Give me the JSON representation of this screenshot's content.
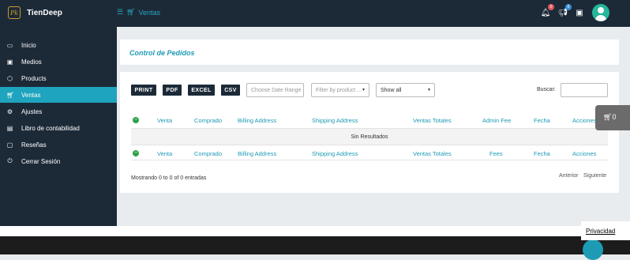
{
  "topbar": {
    "logo_text": "Pk",
    "brand": "TienDeep",
    "breadcrumb": "Ventas",
    "notifications_badge": "0",
    "announcements_badge": "0"
  },
  "sidebar": {
    "items": [
      {
        "label": "Inicio",
        "icon": "monitor-icon"
      },
      {
        "label": "Medios",
        "icon": "image-icon"
      },
      {
        "label": "Products",
        "icon": "box-icon"
      },
      {
        "label": "Ventas",
        "icon": "cart-icon",
        "active": true
      },
      {
        "label": "Ajustes",
        "icon": "gears-icon"
      },
      {
        "label": "Libro de contabilidad",
        "icon": "file-icon"
      },
      {
        "label": "Reseñas",
        "icon": "comment-icon"
      },
      {
        "label": "Cerrar Sesión",
        "icon": "power-icon"
      }
    ]
  },
  "page": {
    "title": "Control de Pedidos"
  },
  "toolbar": {
    "print": "PRINT",
    "pdf": "PDF",
    "excel": "EXCEL",
    "csv": "CSV",
    "date_range_placeholder": "Choose Date Range",
    "product_filter": "Filter by product ...",
    "show_select": "Show all",
    "search_label": "Buscar:"
  },
  "table": {
    "header": [
      "Venta",
      "Comprado",
      "Billing Address",
      "Shipping Address",
      "Ventas Totales",
      "Admin Fee",
      "Fecha",
      "Acciones"
    ],
    "footer": [
      "Venta",
      "Comprado",
      "Billing Address",
      "Shipping Address",
      "Ventas Totales",
      "Fees",
      "Fecha",
      "Acciones"
    ],
    "empty_message": "Sin Resultados",
    "info": "Mostrando 0 to 0 of 0 entradas",
    "prev": "Anterior",
    "next": "Siguiente"
  },
  "float_cart": {
    "count": "0"
  },
  "footer": {
    "privacy": "Privacidad"
  },
  "colors": {
    "accent": "#1ea4be",
    "dark": "#1c2a38",
    "add": "#2fa34a"
  }
}
